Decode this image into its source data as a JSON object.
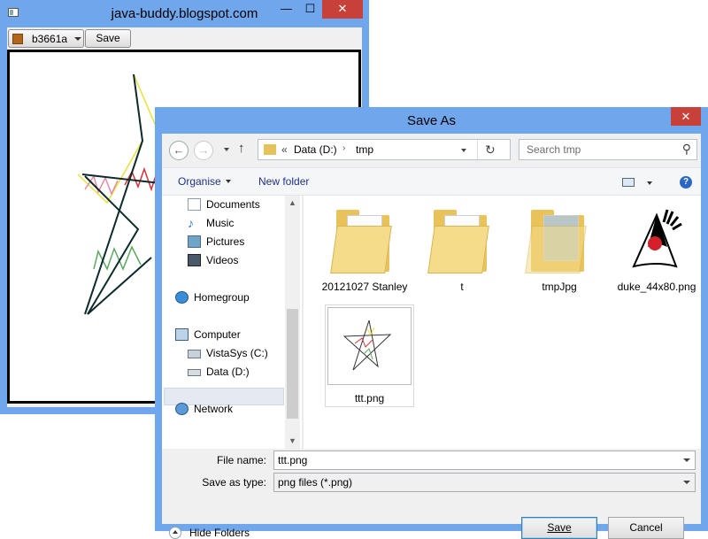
{
  "app": {
    "title": "java-buddy.blogspot.com",
    "min": "—",
    "max": "☐",
    "close": "✕",
    "color_value": "b3661a",
    "save_label": "Save",
    "accent": "#b3661a"
  },
  "dialog": {
    "title": "Save As",
    "close": "✕",
    "address": {
      "prefix": "«",
      "crumb1": "Data (D:)",
      "crumb2": "tmp"
    },
    "search_placeholder": "Search tmp",
    "toolbar": {
      "organise": "Organise",
      "new_folder": "New folder",
      "help": "?"
    },
    "nav": {
      "documents": "Documents",
      "music": "Music",
      "pictures": "Pictures",
      "videos": "Videos",
      "homegroup": "Homegroup",
      "computer": "Computer",
      "vistasys": "VistaSys (C:)",
      "data": "Data (D:)",
      "network": "Network"
    },
    "files": [
      "20121027 Stanley",
      "t",
      "tmpJpg",
      "duke_44x80.png",
      "ttt.png"
    ],
    "file_name_label": "File name:",
    "file_name_value": "ttt.png",
    "save_type_label": "Save as type:",
    "save_type_value": "png files (*.png)",
    "hide_folders": "Hide Folders",
    "save_button": "Save",
    "cancel_button": "Cancel"
  }
}
